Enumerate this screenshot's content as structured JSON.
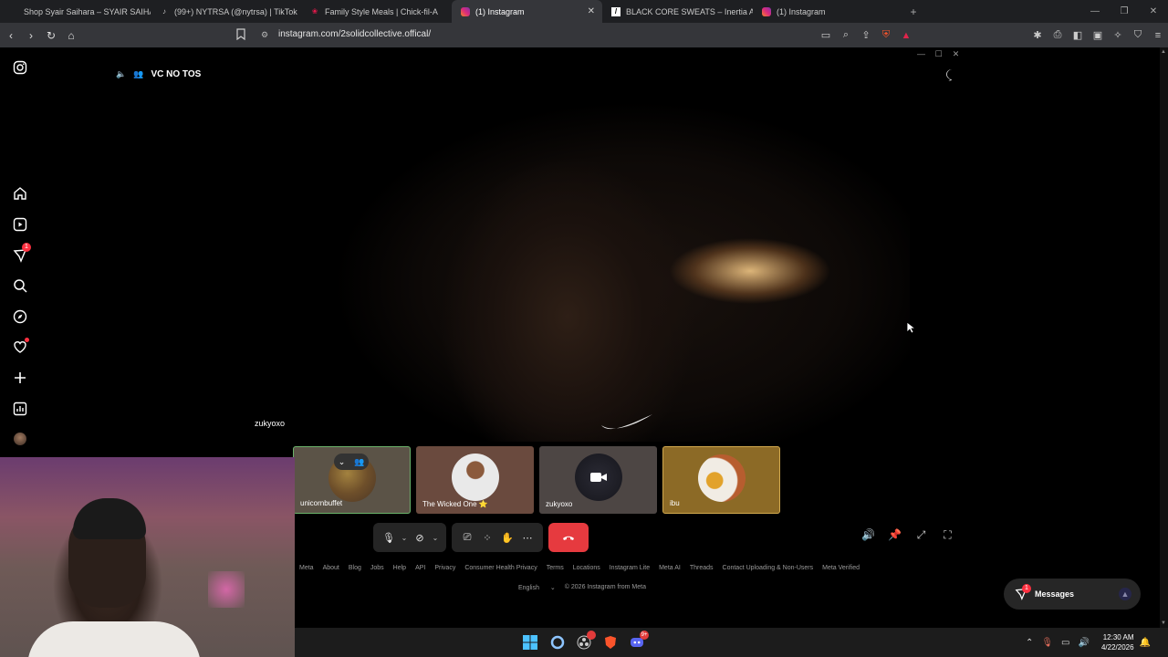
{
  "browser": {
    "tabs": [
      {
        "label": "Shop Syair Saihara – SYAIR SAIHARA",
        "icon": "store-favicon"
      },
      {
        "label": "(99+) NYTRSA (@nytrsa) | TikTok",
        "icon": "tiktok-favicon"
      },
      {
        "label": "Family Style Meals | Chick-fil-A",
        "icon": "chick-fil-a-favicon"
      },
      {
        "label": "(1) Instagram",
        "icon": "instagram-favicon",
        "active": true
      },
      {
        "label": "BLACK CORE SWEATS – Inertia Active",
        "icon": "inertia-favicon"
      },
      {
        "label": "(1) Instagram",
        "icon": "instagram-favicon"
      }
    ],
    "url": "instagram.com/2solidcollective.offical/",
    "accent": "#35363a"
  },
  "call": {
    "group_name": "VC NO TOS",
    "main_speaker": "zukyoxo",
    "participants": [
      {
        "name": "unicornbuffet"
      },
      {
        "name": "The Wicked One ⭐"
      },
      {
        "name": "zukyoxo"
      },
      {
        "name": "ibu"
      }
    ],
    "end_call_color": "#e63a3f"
  },
  "footer": {
    "links": [
      "Meta",
      "About",
      "Blog",
      "Jobs",
      "Help",
      "API",
      "Privacy",
      "Consumer Health Privacy",
      "Terms",
      "Locations",
      "Instagram Lite",
      "Meta AI",
      "Threads",
      "Contact Uploading & Non-Users",
      "Meta Verified"
    ],
    "language": "English",
    "copyright": "© 2026 Instagram from Meta"
  },
  "messages": {
    "label": "Messages",
    "badge": "1"
  },
  "rail": {
    "notifications_badge": "1"
  },
  "taskbar": {
    "time": "12:30 AM",
    "date": "4/22/2026",
    "discord_badge": "9+"
  }
}
